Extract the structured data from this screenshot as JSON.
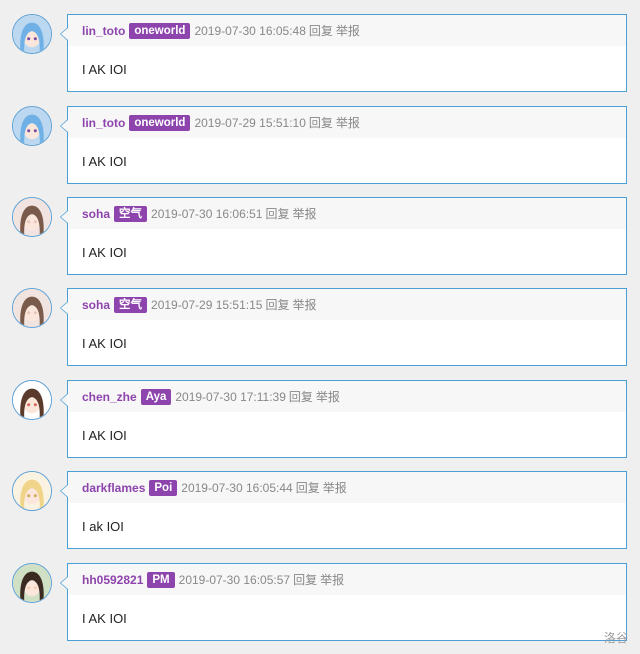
{
  "comments": [
    {
      "user": "lin_toto",
      "badge": "oneworld",
      "time": "2019-07-30 16:05:48",
      "reply": "回复",
      "report": "举报",
      "text": "I AK IOI",
      "avatar": {
        "icon": "anime-avatar-blue-purple",
        "bg": "#bcd7f0",
        "hair": "#6fb1e6",
        "accent": "#7a4aa0"
      }
    },
    {
      "user": "lin_toto",
      "badge": "oneworld",
      "time": "2019-07-29 15:51:10",
      "reply": "回复",
      "report": "举报",
      "text": "I AK IOI",
      "avatar": {
        "icon": "anime-avatar-blue-purple",
        "bg": "#bcd7f0",
        "hair": "#6fb1e6",
        "accent": "#7a4aa0"
      }
    },
    {
      "user": "soha",
      "badge": "空气",
      "time": "2019-07-30 16:06:51",
      "reply": "回复",
      "report": "举报",
      "text": "I AK IOI",
      "avatar": {
        "icon": "anime-avatar-brown-hair",
        "bg": "#f1e4e0",
        "hair": "#7a5a4a",
        "accent": "#e8c6b8"
      }
    },
    {
      "user": "soha",
      "badge": "空气",
      "time": "2019-07-29 15:51:15",
      "reply": "回复",
      "report": "举报",
      "text": "I AK IOI",
      "avatar": {
        "icon": "anime-avatar-brown-hair",
        "bg": "#f1e4e0",
        "hair": "#7a5a4a",
        "accent": "#e8c6b8"
      }
    },
    {
      "user": "chen_zhe",
      "badge": "Aya",
      "time": "2019-07-30 17:11:39",
      "reply": "回复",
      "report": "举报",
      "text": "I AK IOI",
      "avatar": {
        "icon": "anime-avatar-chibi",
        "bg": "#ffffff",
        "hair": "#5a3a2a",
        "accent": "#d8645a"
      }
    },
    {
      "user": "darkflames",
      "badge": "Poi",
      "time": "2019-07-30 16:05:44",
      "reply": "回复",
      "report": "举报",
      "text": "I ak IOI",
      "avatar": {
        "icon": "anime-avatar-blonde",
        "bg": "#fbf3e2",
        "hair": "#f0d48a",
        "accent": "#d2a85a"
      }
    },
    {
      "user": "hh0592821",
      "badge": "PM",
      "time": "2019-07-30 16:05:57",
      "reply": "回复",
      "report": "举报",
      "text": "I AK IOI",
      "avatar": {
        "icon": "anime-avatar-dark-hair",
        "bg": "#cfe0c4",
        "hair": "#3a2a22",
        "accent": "#f2d0b8"
      }
    }
  ],
  "watermark": "洛谷",
  "colors": {
    "accent": "#8e44ad",
    "border": "#4a9fd6",
    "header_bg": "#f7f7f7",
    "page_bg": "#efefef"
  }
}
